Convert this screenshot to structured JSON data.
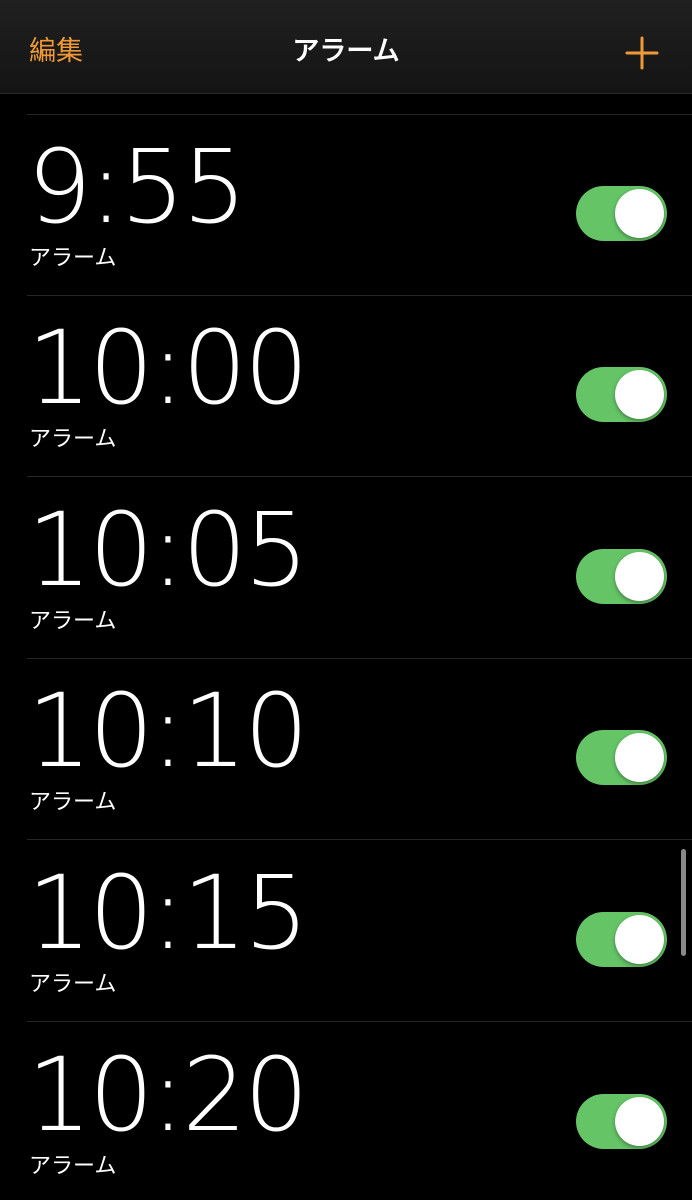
{
  "nav": {
    "edit_label": "編集",
    "title": "アラーム",
    "add_icon": "plus-icon",
    "accent_color": "#F09A37"
  },
  "alarms": [
    {
      "time": "9:55",
      "label": "アラーム",
      "enabled": true
    },
    {
      "time": "10:00",
      "label": "アラーム",
      "enabled": true
    },
    {
      "time": "10:05",
      "label": "アラーム",
      "enabled": true
    },
    {
      "time": "10:10",
      "label": "アラーム",
      "enabled": true
    },
    {
      "time": "10:15",
      "label": "アラーム",
      "enabled": true
    },
    {
      "time": "10:20",
      "label": "アラーム",
      "enabled": true
    }
  ],
  "colors": {
    "toggle_on": "#65C466",
    "background": "#000000"
  }
}
